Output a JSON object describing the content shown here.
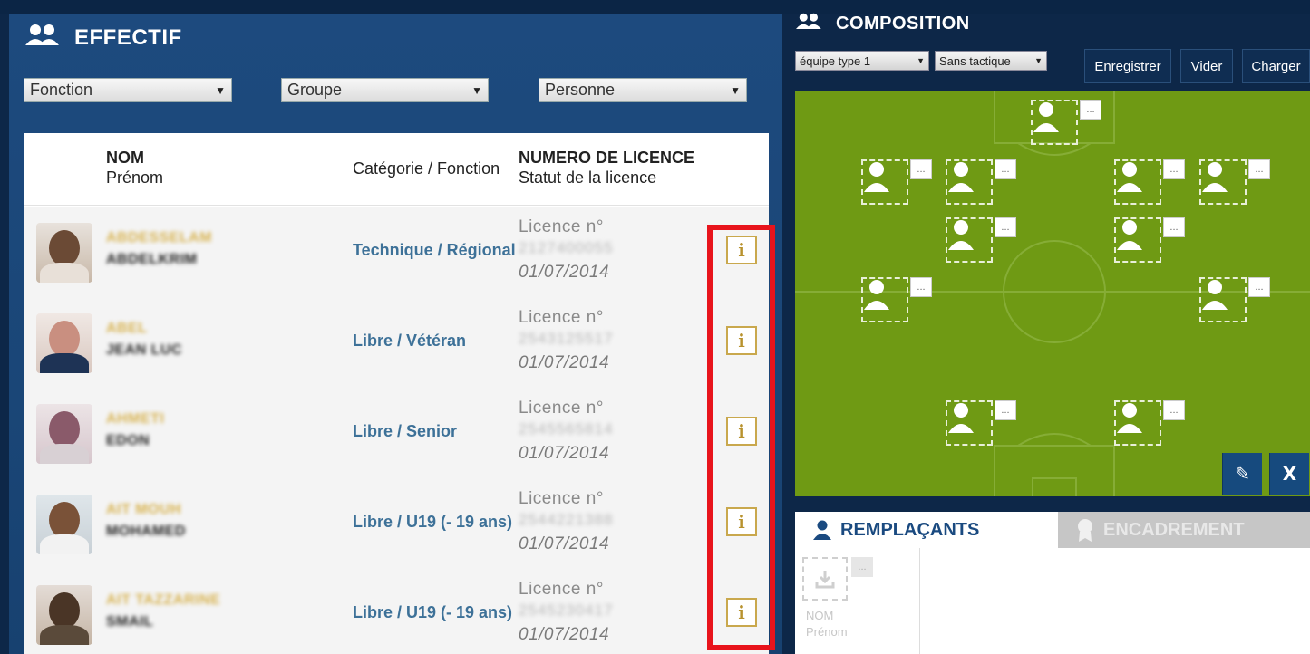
{
  "effectif": {
    "title": "EFFECTIF",
    "filters": [
      {
        "label": "Fonction"
      },
      {
        "label": "Groupe"
      },
      {
        "label": "Personne"
      }
    ],
    "columns": {
      "nom": "NOM",
      "prenom": "Prénom",
      "categorie": "Catégorie / Fonction",
      "licence": "NUMERO DE LICENCE",
      "statut": "Statut de la licence"
    },
    "rows": [
      {
        "name": "ABDESSELAM",
        "firstname": "ABDELKRIM",
        "category": "Technique / Régional",
        "licence_label": "Licence n°",
        "licence_number": "2127400055",
        "date": "01/07/2014",
        "info": "i"
      },
      {
        "name": "ABEL",
        "firstname": "JEAN LUC",
        "category": "Libre / Vétéran",
        "licence_label": "Licence n°",
        "licence_number": "2543125517",
        "date": "01/07/2014",
        "info": "i"
      },
      {
        "name": "AHMETI",
        "firstname": "EDON",
        "category": "Libre / Senior",
        "licence_label": "Licence n°",
        "licence_number": "2545565814",
        "date": "01/07/2014",
        "info": "i"
      },
      {
        "name": "AIT MOUH",
        "firstname": "MOHAMED",
        "category": "Libre / U19 (- 19 ans)",
        "licence_label": "Licence n°",
        "licence_number": "2544221388",
        "date": "01/07/2014",
        "info": "i"
      },
      {
        "name": "AIT TAZZARINE",
        "firstname": "SMAIL",
        "category": "Libre / U19 (- 19 ans)",
        "licence_label": "Licence n°",
        "licence_number": "2545230417",
        "date": "01/07/2014",
        "info": "i"
      }
    ]
  },
  "composition": {
    "title": "COMPOSITION",
    "team_select": "équipe type 1",
    "tactic_select": "Sans tactique",
    "buttons": {
      "save": "Enregistrer",
      "clear": "Vider",
      "load": "Charger"
    },
    "mini_label": "...",
    "tool_edit": "✎",
    "tool_close": "X"
  },
  "tabs": {
    "remplacants": "REMPLAÇANTS",
    "encadrement": "ENCADREMENT"
  },
  "bench": {
    "nom": "NOM",
    "prenom": "Prénom"
  },
  "colors": {
    "accent": "#1a4a80",
    "pitch": "#6f9a14",
    "highlight": "#e8141c",
    "name": "#d7b24f"
  }
}
